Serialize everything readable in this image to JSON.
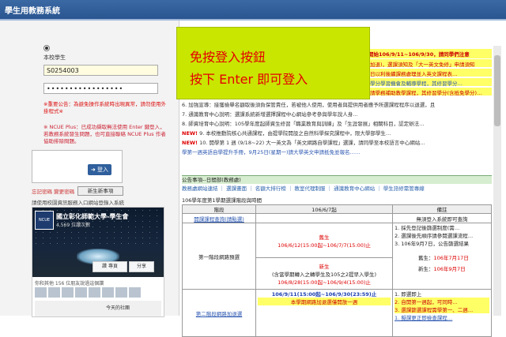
{
  "header": {
    "title": "學生用教務系統"
  },
  "login": {
    "role_label": "本校學生",
    "student_id": "S0254003",
    "password_mask": "•••••••••••••••••",
    "warning1": "※重要公告：為避免操作系統時出現異常，請勿使用外掛程式※",
    "warning2": "※ NCUE Plus：已成功擷取無法使用 Enter 鍵登入，若教務系統發生問題，也可直接聯絡 NCUE Plus 作者協助排除問題。",
    "login_button": "登入",
    "forgot": "忘記密碼  變更密碼",
    "notice_button": "新生新事項",
    "browser_tip": "請使用校園資訊服務入口網站登錄入系統"
  },
  "facebook": {
    "page_name": "國立彰化師範大學-學生會",
    "likes": "4,569 位讚次數",
    "like_button": "讚 專頁",
    "share_button": "分享",
    "friends": "你和其他 156 位朋友說過這個讚",
    "post_text": "今天的社團"
  },
  "overlay": {
    "line1": "免按登入按鈕",
    "line2": "按下 Enter 即可登入"
  },
  "announcements": {
    "band1": "開始106/9/11~106/9/30，請同學們注意",
    "band2": "加退)，選課須知及「大一英文免修」申請須知",
    "band3": "日以利後續課務處理並入英文課程表…",
    "band4": "學分學習機會及輔導學程，其修習學分…",
    "band5": "請學務補助教學課程，其修習學分(含抵免學分)…",
    "line1": "6. 加強宣導：接獲檢舉名額取後須負保管責任，若被他人使用，使用者與提供用者應予所選課程程序以退選，且",
    "line2": "7. 通識教育中心說明：選課系統新增選擇課程中心網站參考參與學年說人身…",
    "line3": "8. 師資培育中心說明：105學年度起師資生修習「職業教育與訓練」及「生涯發展」相關科目，認定辦法…",
    "line4_new": "NEW!",
    "line4": " 9. 本校推動院核心共通課程，由提學院開設之自然科學探究課程中，限大學部學生…",
    "line5_new": "NEW!",
    "line5": " 10. 開學第 1 週 (9/18~22) 大一英文為「英文網路自學課程」選課，請同學至本校語言中心網站…",
    "line6": "學第一週英語自學提升手冊，9月25日(星期一)請大學英文申請抵免並報名……"
  },
  "tabs": {
    "section_title": "公告事項--日間部(教務處)",
    "items": [
      "教務處網站連結",
      "選課畫面",
      "名額大排行榜",
      "教室代理制服",
      "通識教育中心網站",
      "學生諮修需管專線"
    ]
  },
  "table": {
    "title": "106學年度第1學期選課階段與時間",
    "headers": [
      "階段",
      "106/6/7起",
      "備註"
    ],
    "query_link": "開課課程查詢(請點選)",
    "query_note": "無須登入系統即可查詢",
    "stage1": "第一階段網路預選",
    "stage1_top": "舊生",
    "stage1_top_time": "106/6/12(15:00起~106/7/7(15:00)止",
    "stage1_mid": "新生",
    "stage1_mid_note": "(含當學期轉入之轉學生及105之2提早入學生)",
    "stage1_mid_time": "106/8/28(15:00起~106/9/4(15:00)止",
    "stage1_note1": "1. 採先登記後篩選制度(需…",
    "stage1_note2": "2. 選課後先順序請參閱選課流程…",
    "stage1_note3": "3. 106年9月7日，公告篩選結果",
    "old_date_label": "舊生：",
    "old_date": "106年7月17日",
    "new_date_label": "新生：",
    "new_date": "106年9月7日",
    "stage2": "第二階段網路加退選",
    "stage2_time": "106/9/11(15:00起~106/9/30(23:59)止",
    "stage2_note": "本學期網路加退選僅開放一週",
    "stage2_r1": "1. 即選即上",
    "stage2_r2": "2. 自開第一週起，可同時…",
    "stage2_r3": "3. 選課篩選課程需學第一、二週…",
    "stage2_r4": "1. 擬課更正即檢查課程…"
  }
}
